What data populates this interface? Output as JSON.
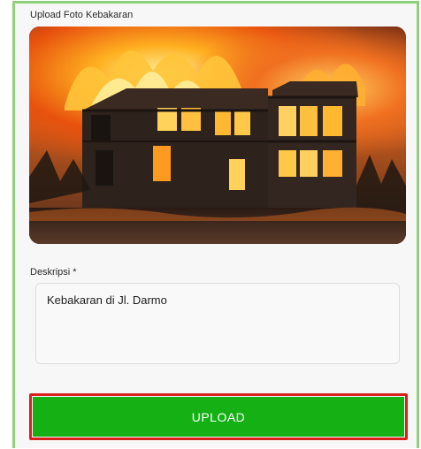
{
  "form": {
    "photo_label": "Upload Foto Kebakaran",
    "photo_alt": "burning-house-photo",
    "description_label": "Deskripsi *",
    "description_value": "Kebakaran di Jl. Darmo",
    "upload_label": "UPLOAD"
  },
  "colors": {
    "frame_border": "#8fd07a",
    "button_bg": "#14b014",
    "button_outline": "#d9201f",
    "button_text": "#ffffff"
  }
}
